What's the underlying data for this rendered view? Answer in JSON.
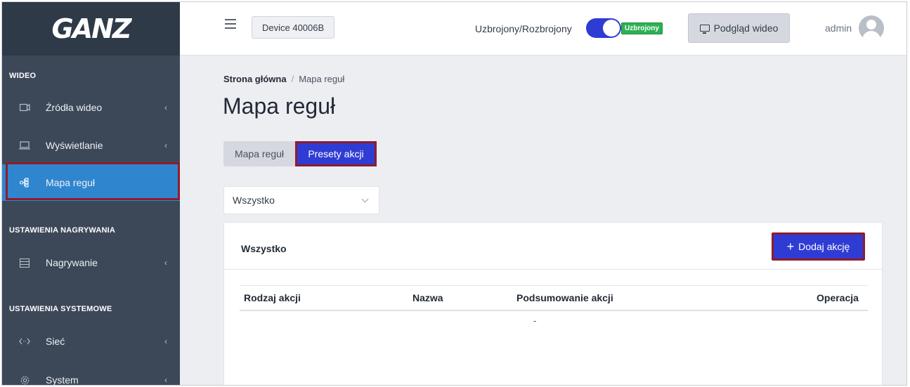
{
  "brand": {
    "logo_text": "GANZ"
  },
  "sidebar": {
    "sections": [
      {
        "title": "WIDEO"
      },
      {
        "title": "USTAWIENIA NAGRYWANIA"
      },
      {
        "title": "USTAWIENIA SYSTEMOWE"
      }
    ],
    "items": [
      {
        "label": "Źródła wideo",
        "icon": "camera-icon",
        "chevron": "‹"
      },
      {
        "label": "Wyświetlanie",
        "icon": "laptop-icon",
        "chevron": "‹"
      },
      {
        "label": "Mapa reguł",
        "icon": "rule-map-icon",
        "active": true
      },
      {
        "label": "Nagrywanie",
        "icon": "list-icon",
        "chevron": "‹"
      },
      {
        "label": "Sieć",
        "icon": "network-icon",
        "chevron": "‹"
      },
      {
        "label": "System",
        "icon": "gear-icon",
        "chevron": "‹"
      }
    ]
  },
  "topbar": {
    "device_label": "Device 40006B",
    "arm_label": "Uzbrojony/Rozbrojony",
    "arm_state_badge": "Uzbrojony",
    "arm_toggle_on": true,
    "preview_label": "Podgląd wideo",
    "user_name": "admin"
  },
  "breadcrumb": {
    "home": "Strona główna",
    "separator": "/",
    "current": "Mapa reguł"
  },
  "page": {
    "title": "Mapa reguł"
  },
  "tabs": [
    {
      "label": "Mapa reguł",
      "active": false
    },
    {
      "label": "Presety akcji",
      "active": true
    }
  ],
  "filter": {
    "selected": "Wszystko"
  },
  "card": {
    "title": "Wszystko",
    "add_button": "Dodaj akcję",
    "add_button_icon": "+",
    "columns": [
      "Rodzaj akcji",
      "Nazwa",
      "Podsumowanie akcji",
      "Operacja"
    ],
    "empty_text": "-"
  },
  "colors": {
    "sidebar_bg": "#3c4858",
    "active_item": "#2f86cf",
    "primary": "#2f3cd4",
    "highlight_outline": "#8f1c2b",
    "armed_badge": "#2cb154"
  }
}
